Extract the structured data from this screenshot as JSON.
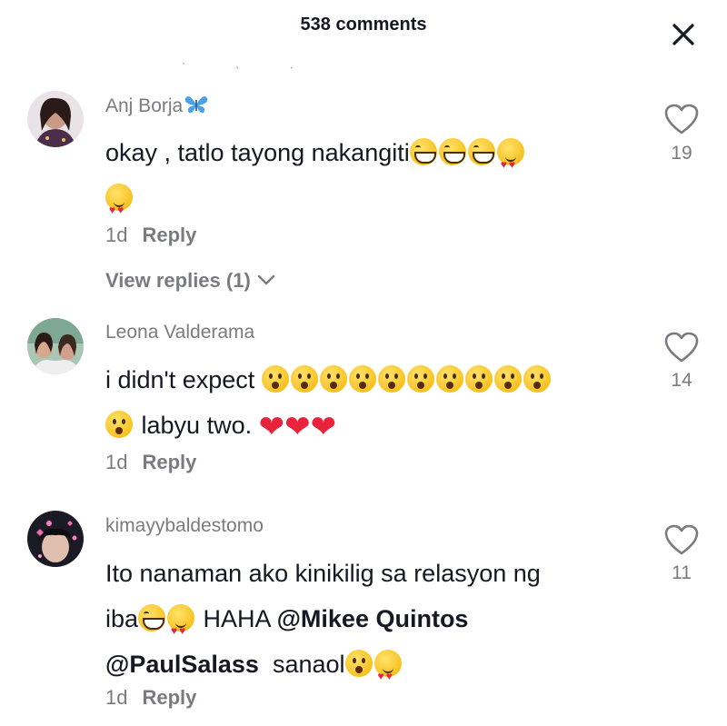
{
  "header": {
    "title": "538 comments",
    "close_icon": "close-icon"
  },
  "comments": [
    {
      "username": "Anj Borja",
      "username_emoji": "butterfly-emoji",
      "text_prefix": "okay , tatlo tayong nakangiti",
      "emojis": [
        "grinning-face",
        "grinning-face",
        "grinning-face",
        "smiling-face-with-hearts",
        "smiling-face-with-hearts"
      ],
      "time": "1d",
      "reply_label": "Reply",
      "view_replies": "View replies (1)",
      "likes": "19"
    },
    {
      "username": "Leona Valderama",
      "text_prefix": "i didn't expect",
      "emojis_line1_count": 10,
      "text_mid": "labyu two.",
      "time": "1d",
      "reply_label": "Reply",
      "likes": "14"
    },
    {
      "username": "kimayybaldestomo",
      "text_line1": "Ito nanaman ako kinikilig sa relasyon ng",
      "text_line2_prefix": "iba",
      "text_line2_mid": "HAHA",
      "mention1": "@Mikee Quintos",
      "mention2": "@PaulSalass",
      "text_line3_suffix": "sanaol",
      "time": "1d",
      "reply_label": "Reply",
      "likes": "11"
    }
  ],
  "colors": {
    "text": "#161823",
    "muted": "#7a7b80",
    "heart_emoji": "#e8243d"
  }
}
